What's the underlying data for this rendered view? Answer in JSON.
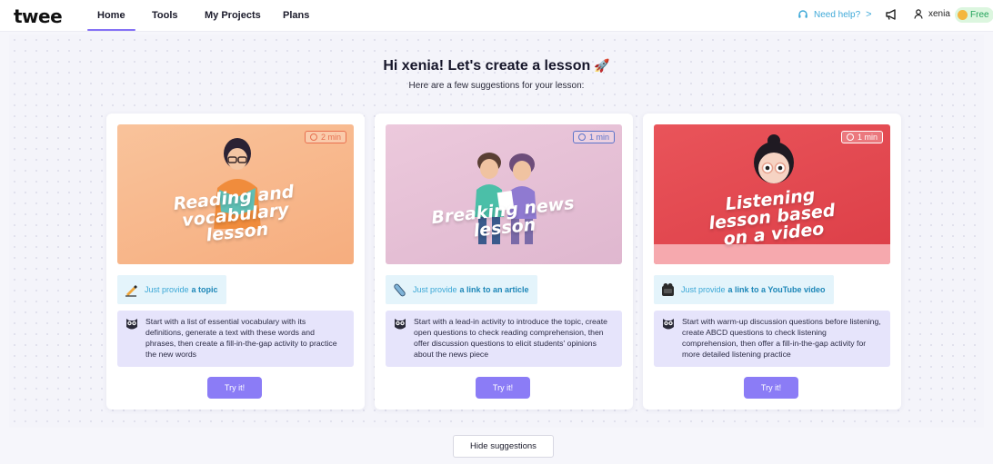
{
  "nav": {
    "logo": "twee",
    "tabs": [
      {
        "label": "Home",
        "active": true
      },
      {
        "label": "Tools",
        "active": false
      },
      {
        "label": "My Projects",
        "active": false
      },
      {
        "label": "Plans",
        "active": false
      }
    ],
    "help_label": "Need help?",
    "help_chevron": ">",
    "username": "xenia",
    "plan_badge": "Free",
    "accent_color": "#8571f5"
  },
  "hero": {
    "title": "Hi xenia! Let's create a lesson",
    "rocket_icon": "🚀",
    "subtitle": "Here are a few suggestions for your lesson:"
  },
  "cards": [
    {
      "image_title": "Reading and vocabulary lesson",
      "image_title_lines": [
        "Reading and",
        "vocabulary",
        "lesson"
      ],
      "duration": "2 min",
      "bg_color": "#f8b78b",
      "chip_color": "#e8704f",
      "provide_prefix": "Just provide",
      "provide_bold": "a topic",
      "provide_icon": "pencil-icon",
      "description": "Start with a list of essential vocabulary with its definitions, generate a text with these words and phrases, then create a fill-in-the-gap activity to practice the new words",
      "button": "Try it!"
    },
    {
      "image_title": "Breaking news lesson",
      "image_title_lines": [
        "Breaking news",
        "lesson"
      ],
      "duration": "1 min",
      "bg_color": "#e7c4d8",
      "chip_color": "#5c73c9",
      "provide_prefix": "Just provide",
      "provide_bold": "a link to an article",
      "provide_icon": "paperclip-icon",
      "description": "Start with a lead-in activity to introduce the topic, create open questions to check reading comprehension, then offer discussion questions to elicit students' opinions about the news piece",
      "button": "Try it!"
    },
    {
      "image_title": "Listening lesson based on a video",
      "image_title_lines": [
        "Listening",
        "lesson based",
        "on a video"
      ],
      "duration": "1 min",
      "bg_color": "#e2474f",
      "chip_color": "#ffffff",
      "provide_prefix": "Just provide",
      "provide_bold": "a link to a YouTube video",
      "provide_icon": "film-icon",
      "description": "Start with warm-up discussion questions before listening, create ABCD questions to check listening comprehension, then offer a fill-in-the-gap activity for more detailed listening practice",
      "button": "Try it!"
    }
  ],
  "footer": {
    "hide_button": "Hide suggestions"
  }
}
